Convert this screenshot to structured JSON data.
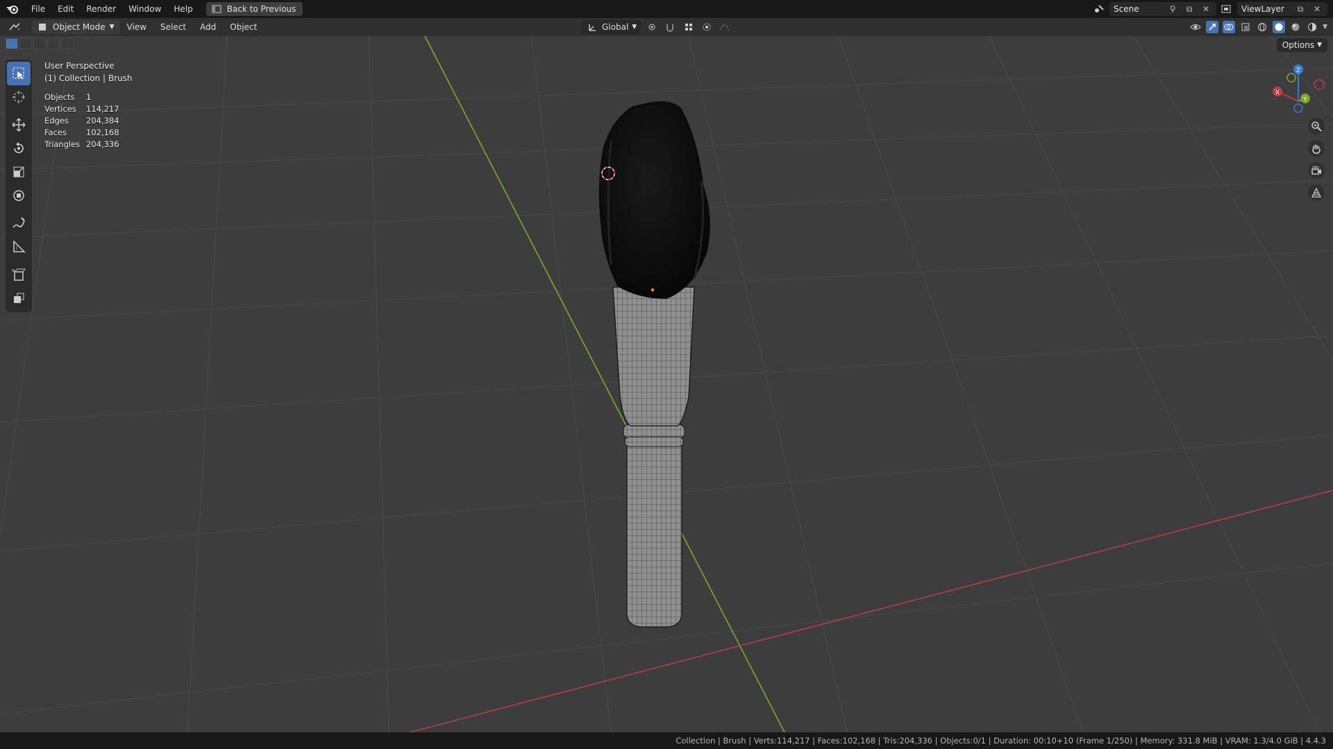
{
  "top_menu": {
    "items": [
      "File",
      "Edit",
      "Render",
      "Window",
      "Help"
    ],
    "back_button": "Back to Previous",
    "scene": "Scene",
    "view_layer": "ViewLayer"
  },
  "header": {
    "mode": "Object Mode",
    "menus": [
      "View",
      "Select",
      "Add",
      "Object"
    ],
    "transform_orientation": "Global"
  },
  "viewport": {
    "view_name": "User Perspective",
    "collection_info": "(1) Collection | Brush",
    "stats": [
      {
        "label": "Objects",
        "value": "1"
      },
      {
        "label": "Vertices",
        "value": "114,217"
      },
      {
        "label": "Edges",
        "value": "204,384"
      },
      {
        "label": "Faces",
        "value": "102,168"
      },
      {
        "label": "Triangles",
        "value": "204,336"
      }
    ],
    "options_label": "Options",
    "gizmo_labels": {
      "x": "X",
      "y": "Y",
      "z": "Z"
    }
  },
  "status_bar": {
    "text": "Collection | Brush | Verts:114,217 | Faces:102,168 | Tris:204,336 | Objects:0/1 | Duration: 00:10+10 (Frame 1/250) | Memory: 331.8 MiB | VRAM: 1.3/4.0 GiB | 4.4.3"
  },
  "colors": {
    "x_axis": "#b53d4a",
    "y_axis": "#7fa827",
    "z_axis": "#3b7ad6",
    "active_tool": "#4772b3",
    "viewport_bg": "#3d3d3d"
  },
  "icons": [
    "blender-logo-icon",
    "back-icon",
    "scene-icon",
    "view-layer-icon",
    "editor-type-icon",
    "object-mode-icon",
    "global-orientation-icon",
    "pivot-icon",
    "snap-icon",
    "proportional-edit-icon",
    "visibility-icon",
    "gizmo-icon",
    "overlay-icon",
    "xray-icon",
    "shading-wireframe-icon",
    "shading-solid-icon",
    "shading-material-icon",
    "shading-rendered-icon",
    "select-box-icon",
    "cursor-icon",
    "move-icon",
    "rotate-icon",
    "scale-icon",
    "transform-icon",
    "annotate-icon",
    "measure-icon",
    "add-cube-icon",
    "add-object-icon",
    "zoom-icon",
    "pan-icon",
    "camera-icon",
    "ortho-grid-icon"
  ]
}
